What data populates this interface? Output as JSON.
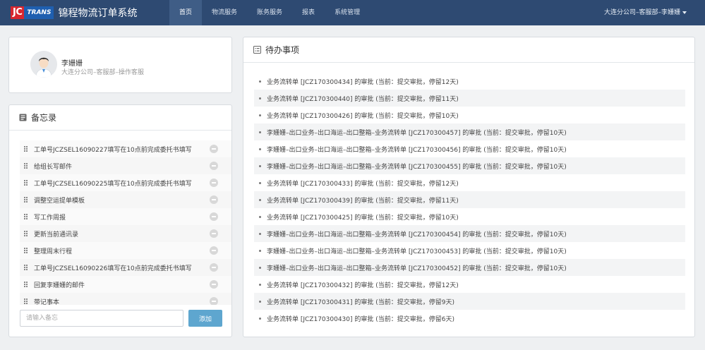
{
  "brand": {
    "logo_jc": "JC",
    "logo_trans": "TRANS",
    "title": "锦程物流订单系统"
  },
  "nav": {
    "items": [
      {
        "label": "首页",
        "active": true
      },
      {
        "label": "物流服务",
        "active": false
      },
      {
        "label": "账务服务",
        "active": false
      },
      {
        "label": "报表",
        "active": false
      },
      {
        "label": "系统管理",
        "active": false
      }
    ],
    "user": "大连分公司–客服部–李姗姗"
  },
  "profile": {
    "name": "李姗姗",
    "department": "大连分公司–客服部–操作客服"
  },
  "memo": {
    "title": "备忘录",
    "items": [
      "工单号JCZSEL16090227填写在10点前完成委托书填写",
      "给组长写邮件",
      "工单号JCZSEL16090225填写在10点前完成委托书填写",
      "调整空运提单模板",
      "写工作周报",
      "更新当前通讯录",
      "整理周末行程",
      "工单号JCZSEL16090226填写在10点前完成委托书填写",
      "回复李姗姗的邮件",
      "带记事本"
    ],
    "input_placeholder": "请输入备忘",
    "add_label": "添加"
  },
  "todo": {
    "title": "待办事项",
    "items": [
      "业务流转单 [JCZ170300434] 的审批 (当前：提交审批，停留12天)",
      "业务流转单 [JCZ170300440] 的审批 (当前：提交审批，停留11天)",
      "业务流转单 [JCZ170300426] 的审批 (当前：提交审批，停留10天)",
      "李姗姗–出口业务–出口海运–出口整箱–业务流转单 [JCZ170300457] 的审批 (当前：提交审批，停留10天)",
      "李姗姗–出口业务–出口海运–出口整箱–业务流转单 [JCZ170300456] 的审批 (当前：提交审批，停留10天)",
      "李姗姗–出口业务–出口海运–出口整箱–业务流转单 [JCZ170300455] 的审批 (当前：提交审批，停留10天)",
      "业务流转单 [JCZ170300433] 的审批 (当前：提交审批，停留12天)",
      "业务流转单 [JCZ170300439] 的审批 (当前：提交审批，停留11天)",
      "业务流转单 [JCZ170300425] 的审批 (当前：提交审批，停留10天)",
      "李姗姗–出口业务–出口海运–出口整箱–业务流转单 [JCZ170300454] 的审批 (当前：提交审批，停留10天)",
      "李姗姗–出口业务–出口海运–出口整箱–业务流转单 [JCZ170300453] 的审批 (当前：提交审批，停留10天)",
      "李姗姗–出口业务–出口海运–出口整箱–业务流转单 [JCZ170300452] 的审批 (当前：提交审批，停留10天)",
      "业务流转单 [JCZ170300432] 的审批 (当前：提交审批，停留12天)",
      "业务流转单 [JCZ170300431] 的审批 (当前：提交审批，停留9天)",
      "业务流转单 [JCZ170300430] 的审批 (当前：提交审批，停留6天)"
    ]
  },
  "colors": {
    "navbar": "#2e4a72",
    "nav_active": "#3f5d86",
    "logo_red": "#d8262f",
    "logo_blue": "#1f5fb0",
    "add_button": "#5ea6cf"
  }
}
